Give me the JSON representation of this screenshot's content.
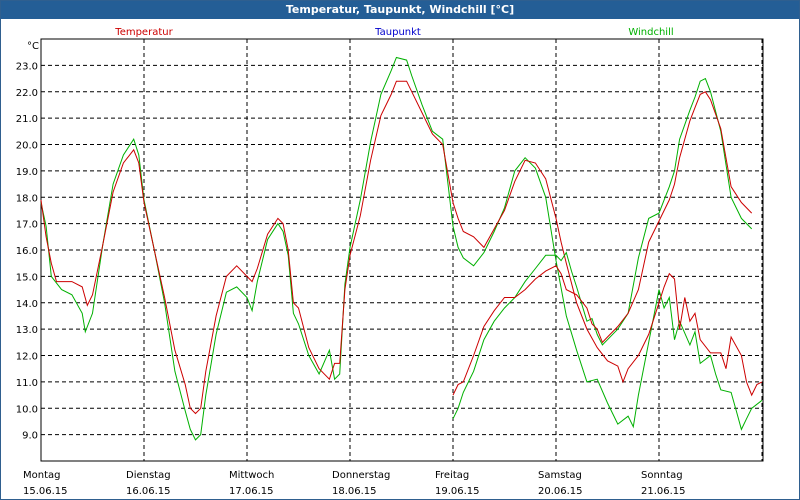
{
  "window": {
    "title": "Temperatur, Taupunkt, Windchill [°C]"
  },
  "chart_data": {
    "type": "line",
    "title": "Temperatur, Taupunkt, Windchill [°C]",
    "ylabel": "°C",
    "ylim": [
      8.0,
      24.0
    ],
    "yticks": [
      9.0,
      10.0,
      11.0,
      12.0,
      13.0,
      14.0,
      15.0,
      16.0,
      17.0,
      18.0,
      19.0,
      20.0,
      21.0,
      22.0,
      23.0
    ],
    "xlim": [
      0,
      7
    ],
    "grid": true,
    "legend_placement": "top",
    "days": [
      {
        "weekday": "Montag",
        "date": "15.06.15"
      },
      {
        "weekday": "Dienstag",
        "date": "16.06.15"
      },
      {
        "weekday": "Mittwoch",
        "date": "17.06.15"
      },
      {
        "weekday": "Donnerstag",
        "date": "18.06.15"
      },
      {
        "weekday": "Freitag",
        "date": "19.06.15"
      },
      {
        "weekday": "Samstag",
        "date": "20.06.15"
      },
      {
        "weekday": "Sonntag",
        "date": "21.06.15"
      }
    ],
    "series": [
      {
        "name": "Temperatur",
        "color": "#cc0000",
        "points": [
          [
            0,
            17.9
          ],
          [
            0.05,
            16.5
          ],
          [
            0.1,
            15.5
          ],
          [
            0.15,
            14.8
          ],
          [
            0.3,
            14.8
          ],
          [
            0.4,
            14.6
          ],
          [
            0.45,
            13.9
          ],
          [
            0.5,
            14.3
          ],
          [
            0.6,
            16.2
          ],
          [
            0.7,
            18.2
          ],
          [
            0.8,
            19.3
          ],
          [
            0.9,
            19.8
          ],
          [
            0.95,
            19.3
          ],
          [
            1.0,
            17.8
          ],
          [
            1.1,
            16.0
          ],
          [
            1.2,
            14.2
          ],
          [
            1.3,
            12.2
          ],
          [
            1.4,
            10.9
          ],
          [
            1.45,
            10.0
          ],
          [
            1.5,
            9.8
          ],
          [
            1.55,
            10.0
          ],
          [
            1.6,
            11.4
          ],
          [
            1.7,
            13.5
          ],
          [
            1.8,
            15.0
          ],
          [
            1.9,
            15.4
          ],
          [
            2.0,
            15.0
          ],
          [
            2.05,
            14.8
          ],
          [
            2.1,
            15.3
          ],
          [
            2.2,
            16.6
          ],
          [
            2.3,
            17.2
          ],
          [
            2.35,
            17.0
          ],
          [
            2.4,
            16.0
          ],
          [
            2.45,
            14.0
          ],
          [
            2.5,
            13.8
          ],
          [
            2.6,
            12.3
          ],
          [
            2.7,
            11.5
          ],
          [
            2.8,
            11.1
          ],
          [
            2.85,
            11.7
          ],
          [
            2.9,
            11.7
          ],
          [
            2.95,
            14.5
          ],
          [
            3.0,
            15.8
          ],
          [
            3.1,
            17.3
          ],
          [
            3.2,
            19.4
          ],
          [
            3.3,
            21.1
          ],
          [
            3.4,
            21.9
          ],
          [
            3.45,
            22.4
          ],
          [
            3.55,
            22.4
          ],
          [
            3.6,
            22.0
          ],
          [
            3.7,
            21.2
          ],
          [
            3.8,
            20.4
          ],
          [
            3.9,
            20.0
          ],
          [
            4.0,
            17.8
          ],
          [
            4.05,
            17.2
          ],
          [
            4.1,
            16.7
          ],
          [
            4.2,
            16.5
          ],
          [
            4.3,
            16.1
          ],
          [
            4.4,
            16.8
          ],
          [
            4.5,
            17.5
          ],
          [
            4.6,
            18.6
          ],
          [
            4.7,
            19.4
          ],
          [
            4.8,
            19.3
          ],
          [
            4.9,
            18.7
          ],
          [
            5.0,
            17.2
          ],
          [
            5.05,
            16.3
          ],
          [
            5.1,
            15.5
          ],
          [
            5.2,
            14.0
          ],
          [
            5.3,
            13.0
          ],
          [
            5.4,
            12.3
          ],
          [
            5.5,
            11.8
          ],
          [
            5.6,
            11.6
          ],
          [
            5.65,
            11.0
          ],
          [
            5.7,
            11.5
          ],
          [
            5.8,
            12.0
          ],
          [
            5.9,
            12.8
          ],
          [
            6.0,
            14.0
          ],
          [
            6.05,
            14.6
          ],
          [
            6.1,
            15.1
          ],
          [
            6.15,
            14.9
          ],
          [
            6.2,
            13.0
          ],
          [
            6.25,
            14.2
          ],
          [
            6.3,
            13.3
          ],
          [
            6.35,
            13.6
          ],
          [
            6.4,
            12.6
          ],
          [
            6.5,
            12.1
          ],
          [
            6.6,
            12.1
          ],
          [
            6.65,
            11.5
          ],
          [
            6.7,
            12.7
          ],
          [
            6.8,
            12.0
          ],
          [
            6.85,
            11.0
          ],
          [
            6.9,
            10.5
          ],
          [
            6.95,
            10.9
          ],
          [
            7.0,
            11.0
          ]
        ]
      },
      {
        "name": "Taupunkt",
        "color": "#0000cc",
        "points": []
      },
      {
        "name": "Windchill",
        "color": "#00b000",
        "points": [
          [
            0,
            17.8
          ],
          [
            0.05,
            16.9
          ],
          [
            0.1,
            15.0
          ],
          [
            0.2,
            14.5
          ],
          [
            0.3,
            14.3
          ],
          [
            0.4,
            13.6
          ],
          [
            0.43,
            12.9
          ],
          [
            0.5,
            13.6
          ],
          [
            0.6,
            16.2
          ],
          [
            0.7,
            18.5
          ],
          [
            0.8,
            19.6
          ],
          [
            0.9,
            20.2
          ],
          [
            0.95,
            19.6
          ],
          [
            1.0,
            17.9
          ],
          [
            1.1,
            16.0
          ],
          [
            1.2,
            14.0
          ],
          [
            1.3,
            11.4
          ],
          [
            1.4,
            9.9
          ],
          [
            1.45,
            9.2
          ],
          [
            1.5,
            8.8
          ],
          [
            1.55,
            9.0
          ],
          [
            1.6,
            10.5
          ],
          [
            1.7,
            12.8
          ],
          [
            1.8,
            14.4
          ],
          [
            1.9,
            14.6
          ],
          [
            2.0,
            14.2
          ],
          [
            2.05,
            13.7
          ],
          [
            2.1,
            14.8
          ],
          [
            2.2,
            16.4
          ],
          [
            2.3,
            17.0
          ],
          [
            2.35,
            16.7
          ],
          [
            2.4,
            15.8
          ],
          [
            2.45,
            13.6
          ],
          [
            2.5,
            13.2
          ],
          [
            2.6,
            12.0
          ],
          [
            2.7,
            11.3
          ],
          [
            2.8,
            12.2
          ],
          [
            2.85,
            11.1
          ],
          [
            2.9,
            11.3
          ],
          [
            2.95,
            14.7
          ],
          [
            3.0,
            16.1
          ],
          [
            3.1,
            17.9
          ],
          [
            3.2,
            20.1
          ],
          [
            3.3,
            21.9
          ],
          [
            3.4,
            22.8
          ],
          [
            3.45,
            23.3
          ],
          [
            3.55,
            23.2
          ],
          [
            3.6,
            22.6
          ],
          [
            3.7,
            21.5
          ],
          [
            3.8,
            20.5
          ],
          [
            3.9,
            20.2
          ],
          [
            4.0,
            16.9
          ],
          [
            4.05,
            16.1
          ],
          [
            4.1,
            15.7
          ],
          [
            4.2,
            15.4
          ],
          [
            4.3,
            15.9
          ],
          [
            4.4,
            16.7
          ],
          [
            4.5,
            17.6
          ],
          [
            4.6,
            19.0
          ],
          [
            4.7,
            19.5
          ],
          [
            4.8,
            19.1
          ],
          [
            4.9,
            18.0
          ],
          [
            5.0,
            15.6
          ],
          [
            5.1,
            13.5
          ],
          [
            5.2,
            12.2
          ],
          [
            5.3,
            11.0
          ],
          [
            5.4,
            11.1
          ],
          [
            5.5,
            10.2
          ],
          [
            5.6,
            9.4
          ],
          [
            5.7,
            9.7
          ],
          [
            5.75,
            9.3
          ],
          [
            5.8,
            10.5
          ],
          [
            5.9,
            12.5
          ],
          [
            6.0,
            14.5
          ],
          [
            6.05,
            13.8
          ],
          [
            6.1,
            14.2
          ],
          [
            6.15,
            12.6
          ],
          [
            6.2,
            13.3
          ],
          [
            6.3,
            12.4
          ],
          [
            6.35,
            12.9
          ],
          [
            6.4,
            11.7
          ],
          [
            6.5,
            12.0
          ],
          [
            6.55,
            11.3
          ],
          [
            6.6,
            10.7
          ],
          [
            6.7,
            10.6
          ],
          [
            6.75,
            9.9
          ],
          [
            6.8,
            9.2
          ],
          [
            6.85,
            9.6
          ],
          [
            6.9,
            10.0
          ],
          [
            7.0,
            10.3
          ]
        ]
      }
    ],
    "series_right": [
      {
        "name": "Temperatur",
        "points": [
          [
            0,
            10.5
          ],
          [
            0.05,
            10.9
          ],
          [
            0.1,
            11.0
          ],
          [
            0.2,
            12.0
          ],
          [
            0.3,
            13.1
          ],
          [
            0.4,
            13.7
          ],
          [
            0.5,
            14.2
          ],
          [
            0.6,
            14.2
          ],
          [
            0.7,
            14.5
          ],
          [
            0.8,
            14.9
          ],
          [
            0.9,
            15.2
          ],
          [
            1.0,
            15.4
          ],
          [
            1.05,
            15.1
          ],
          [
            1.1,
            14.5
          ],
          [
            1.2,
            14.3
          ],
          [
            1.3,
            13.8
          ],
          [
            1.35,
            13.2
          ],
          [
            1.4,
            13.0
          ],
          [
            1.45,
            12.5
          ],
          [
            1.5,
            12.7
          ],
          [
            1.6,
            13.1
          ],
          [
            1.7,
            13.6
          ],
          [
            1.8,
            14.5
          ],
          [
            1.9,
            16.3
          ],
          [
            2.0,
            17.1
          ],
          [
            2.1,
            17.9
          ],
          [
            2.15,
            18.5
          ],
          [
            2.2,
            19.5
          ],
          [
            2.3,
            20.9
          ],
          [
            2.35,
            21.4
          ],
          [
            2.4,
            21.9
          ],
          [
            2.45,
            22.0
          ],
          [
            2.5,
            21.7
          ],
          [
            2.6,
            20.6
          ],
          [
            2.7,
            18.4
          ],
          [
            2.8,
            17.8
          ],
          [
            2.9,
            17.4
          ]
        ]
      },
      {
        "name": "Windchill",
        "points": [
          [
            0,
            9.6
          ],
          [
            0.05,
            10.0
          ],
          [
            0.1,
            10.6
          ],
          [
            0.2,
            11.4
          ],
          [
            0.3,
            12.6
          ],
          [
            0.4,
            13.3
          ],
          [
            0.5,
            13.8
          ],
          [
            0.6,
            14.2
          ],
          [
            0.7,
            14.8
          ],
          [
            0.8,
            15.3
          ],
          [
            0.9,
            15.8
          ],
          [
            1.0,
            15.8
          ],
          [
            1.05,
            15.6
          ],
          [
            1.1,
            15.9
          ],
          [
            1.15,
            15.2
          ],
          [
            1.2,
            14.6
          ],
          [
            1.3,
            13.3
          ],
          [
            1.35,
            13.4
          ],
          [
            1.4,
            12.8
          ],
          [
            1.45,
            12.4
          ],
          [
            1.5,
            12.6
          ],
          [
            1.6,
            13.0
          ],
          [
            1.7,
            13.6
          ],
          [
            1.8,
            15.7
          ],
          [
            1.9,
            17.2
          ],
          [
            2.0,
            17.4
          ],
          [
            2.1,
            18.4
          ],
          [
            2.15,
            19.0
          ],
          [
            2.2,
            20.2
          ],
          [
            2.3,
            21.3
          ],
          [
            2.35,
            21.8
          ],
          [
            2.4,
            22.4
          ],
          [
            2.45,
            22.5
          ],
          [
            2.5,
            22.0
          ],
          [
            2.6,
            20.5
          ],
          [
            2.7,
            18.0
          ],
          [
            2.8,
            17.2
          ],
          [
            2.9,
            16.8
          ]
        ]
      }
    ]
  }
}
